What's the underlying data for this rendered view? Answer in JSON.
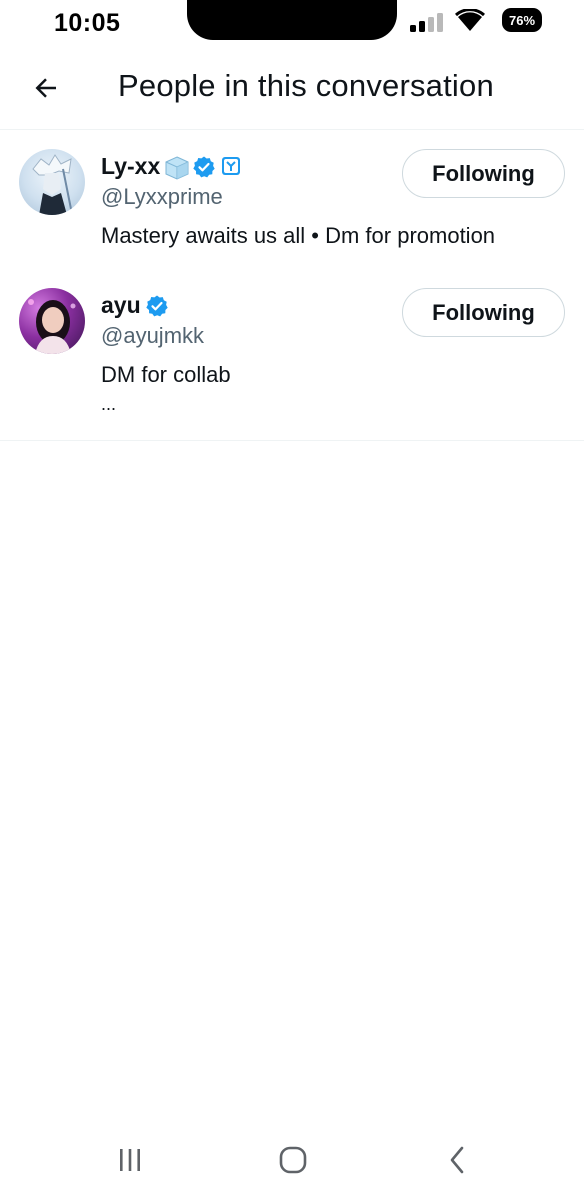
{
  "status_bar": {
    "time": "10:05",
    "battery_percent": "76%",
    "signal_bars_active": 2,
    "signal_bars_total": 4
  },
  "header": {
    "back_icon": "arrow-left-icon",
    "title": "People in this conversation"
  },
  "users": [
    {
      "display_name": "Ly-xx",
      "handle": "@Lyxxprime",
      "bio": "Mastery awaits us all • Dm for promotion",
      "follow_label": "Following",
      "badges": [
        "ice-cube-emoji-icon",
        "verified-badge-icon",
        "affiliate-badge-icon"
      ]
    },
    {
      "display_name": "ayu",
      "handle": "@ayujmkk",
      "bio": "DM for collab",
      "bio_more": "...",
      "follow_label": "Following",
      "badges": [
        "verified-badge-icon"
      ]
    }
  ],
  "nav": {
    "items": [
      "recent-apps-icon",
      "home-icon",
      "back-icon"
    ]
  },
  "colors": {
    "verified_blue": "#1d9bf0",
    "secondary_text": "#536471",
    "primary_text": "#0f1419",
    "divider": "#eff3f4"
  }
}
